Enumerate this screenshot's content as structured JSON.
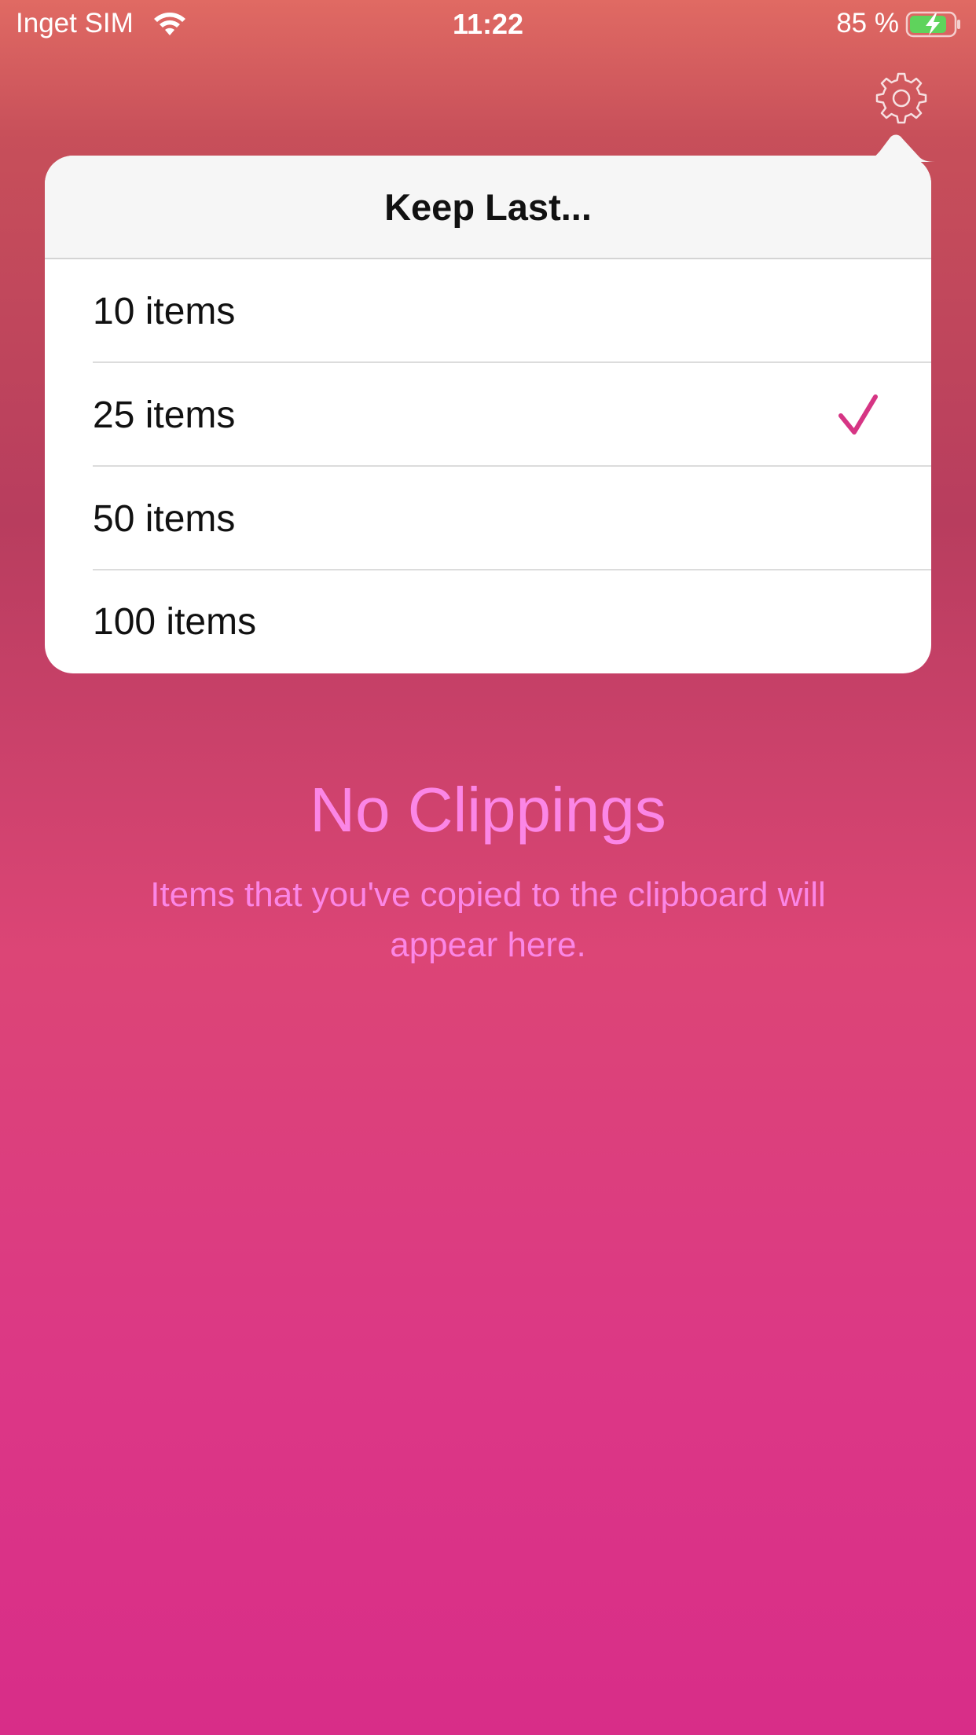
{
  "status_bar": {
    "carrier": "Inget SIM",
    "time": "11:22",
    "battery_percent": "85 %",
    "wifi_icon": "wifi-icon",
    "battery_icon": "battery-charging-icon"
  },
  "toolbar": {
    "settings_icon": "gear-icon"
  },
  "popover": {
    "title": "Keep Last...",
    "options": [
      {
        "label": "10 items",
        "selected": false
      },
      {
        "label": "25 items",
        "selected": true
      },
      {
        "label": "50 items",
        "selected": false
      },
      {
        "label": "100 items",
        "selected": false
      }
    ],
    "check_icon": "checkmark-icon"
  },
  "empty_state": {
    "title": "No Clippings",
    "subtitle": "Items that you've copied to the clipboard will appear here."
  },
  "colors": {
    "accent": "#d63584",
    "empty_text": "#fb86e6",
    "battery_fill": "#5fd35c"
  }
}
